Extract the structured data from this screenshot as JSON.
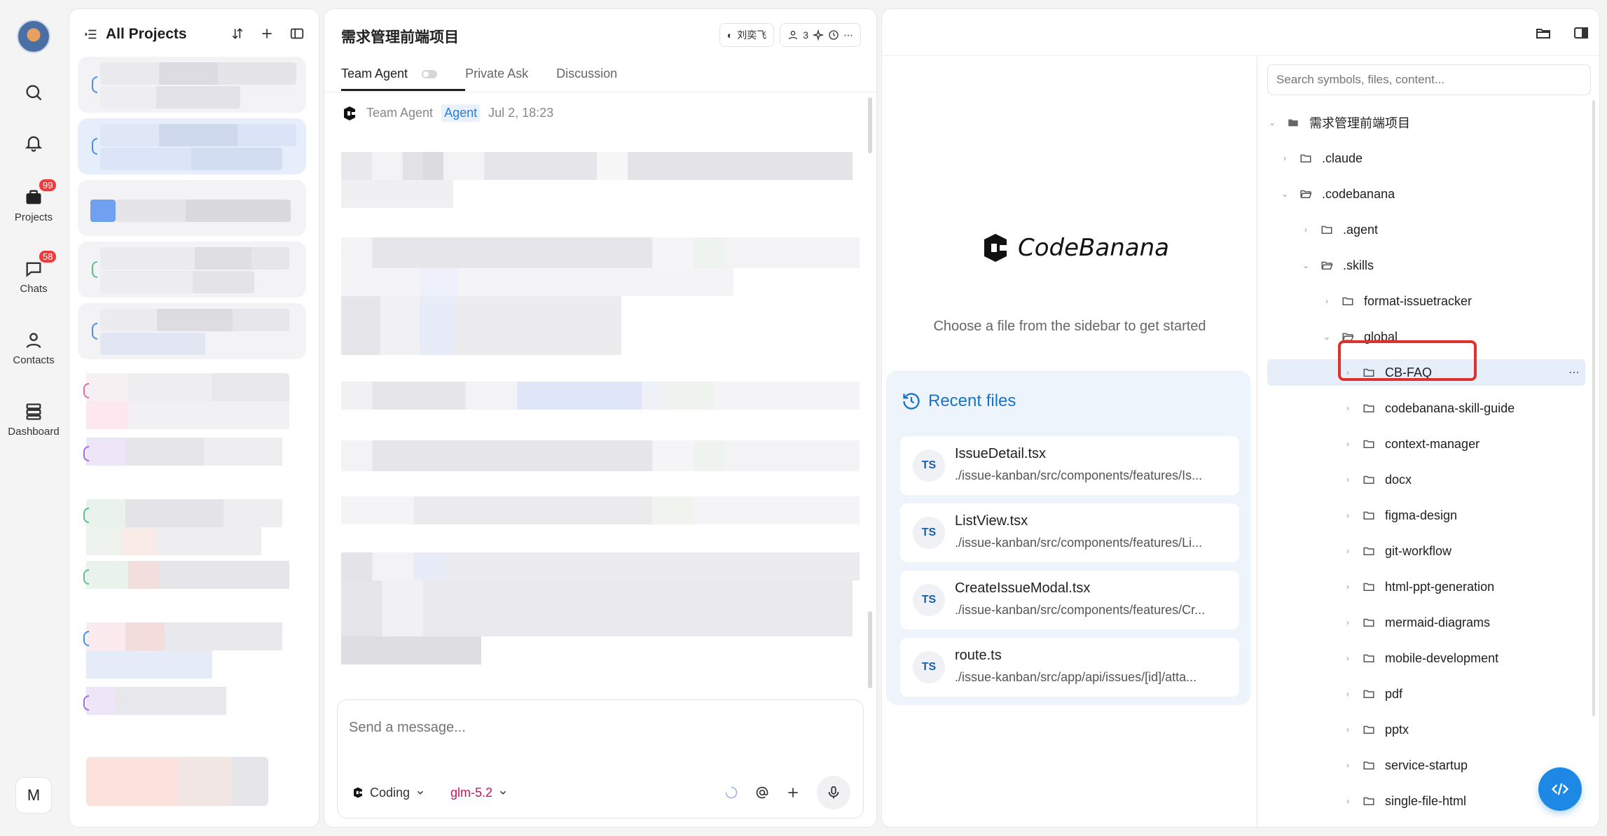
{
  "rail": {
    "items": [
      {
        "icon": "search-icon",
        "label": ""
      },
      {
        "icon": "bell-icon",
        "label": ""
      },
      {
        "icon": "projects-icon",
        "label": "Projects",
        "badge": "99"
      },
      {
        "icon": "chats-icon",
        "label": "Chats",
        "badge": "58"
      },
      {
        "icon": "contacts-icon",
        "label": "Contacts"
      },
      {
        "icon": "dashboard-icon",
        "label": "Dashboard"
      }
    ],
    "user_initial": "M"
  },
  "projects": {
    "title": "All Projects"
  },
  "chat": {
    "title": "需求管理前端项目",
    "member_name": "刘奕飞",
    "member_count": "3",
    "tabs": [
      "Team Agent",
      "Private Ask",
      "Discussion"
    ],
    "message": {
      "sender": "Team Agent",
      "tag": "Agent",
      "time": "Jul 2, 18:23"
    },
    "composer": {
      "placeholder": "Send a message...",
      "mode": "Coding",
      "model": "glm-5.2"
    }
  },
  "viewer": {
    "logo_text": "CodeBanana",
    "hint": "Choose a file from the sidebar to get started",
    "recent_title": "Recent files",
    "recent_files": [
      {
        "type": "TS",
        "name": "IssueDetail.tsx",
        "path": "./issue-kanban/src/components/features/Is..."
      },
      {
        "type": "TS",
        "name": "ListView.tsx",
        "path": "./issue-kanban/src/components/features/Li..."
      },
      {
        "type": "TS",
        "name": "CreateIssueModal.tsx",
        "path": "./issue-kanban/src/components/features/Cr..."
      },
      {
        "type": "TS",
        "name": "route.ts",
        "path": "./issue-kanban/src/app/api/issues/[id]/atta..."
      }
    ]
  },
  "tree": {
    "search_placeholder": "Search symbols, files, content...",
    "root": "需求管理前端项目",
    "nodes": [
      {
        "label": ".claude"
      },
      {
        "label": ".codebanana"
      },
      {
        "label": ".agent"
      },
      {
        "label": ".skills"
      },
      {
        "label": "format-issuetracker"
      },
      {
        "label": "global"
      },
      {
        "label": "CB-FAQ"
      },
      {
        "label": "codebanana-skill-guide"
      },
      {
        "label": "context-manager"
      },
      {
        "label": "docx"
      },
      {
        "label": "figma-design"
      },
      {
        "label": "git-workflow"
      },
      {
        "label": "html-ppt-generation"
      },
      {
        "label": "mermaid-diagrams"
      },
      {
        "label": "mobile-development"
      },
      {
        "label": "pdf"
      },
      {
        "label": "pptx"
      },
      {
        "label": "service-startup"
      },
      {
        "label": "single-file-html"
      }
    ]
  },
  "colors": {
    "accent": "#1e88e5",
    "badge": "#ef3b3b",
    "highlight": "#e0312e",
    "model": "#c2185b"
  }
}
